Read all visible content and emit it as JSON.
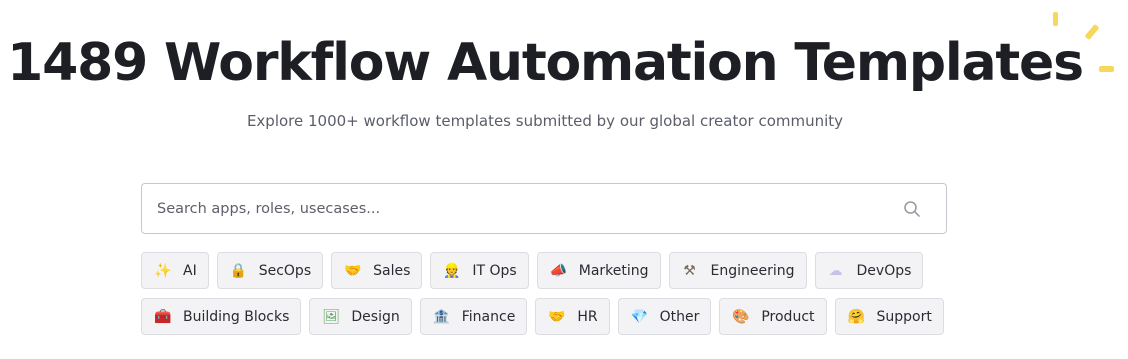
{
  "hero": {
    "title": "1489 Workflow Automation Templates",
    "subtitle": "Explore 1000+ workflow templates submitted by our global creator community",
    "sparkle_color": "#f6d95b"
  },
  "search": {
    "placeholder": "Search apps, roles, usecases...",
    "value": "",
    "icon": "search-icon"
  },
  "categories": {
    "row1": [
      {
        "emoji": "✨",
        "label": "AI",
        "icon": "sparkles-icon",
        "color": "#f5b400"
      },
      {
        "emoji": "🔒",
        "label": "SecOps",
        "icon": "lock-icon",
        "color": "#e0a81c"
      },
      {
        "emoji": "🤝",
        "label": "Sales",
        "icon": "handshake-icon",
        "color": "#e9a420"
      },
      {
        "emoji": "👷",
        "label": "IT Ops",
        "icon": "construction-worker-icon",
        "color": "#c48a2a"
      },
      {
        "emoji": "📣",
        "label": "Marketing",
        "icon": "megaphone-icon",
        "color": "#f0a81c"
      },
      {
        "emoji": "⚒",
        "label": "Engineering",
        "icon": "hammer-pick-icon",
        "color": "#7a6a5a"
      },
      {
        "emoji": "☁",
        "label": "DevOps",
        "icon": "cloud-icon",
        "color": "#c7c3e8"
      }
    ],
    "row2": [
      {
        "emoji": "🧰",
        "label": "Building Blocks",
        "icon": "toolbox-icon",
        "color": "#d93a3a"
      },
      {
        "emoji": "🖼",
        "label": "Design",
        "icon": "framed-picture-icon",
        "color": "#5aa35a"
      },
      {
        "emoji": "🏦",
        "label": "Finance",
        "icon": "bank-icon",
        "color": "#8a8f99"
      },
      {
        "emoji": "🤝",
        "label": "HR",
        "icon": "handshake-icon",
        "color": "#e9a420"
      },
      {
        "emoji": "💎",
        "label": "Other",
        "icon": "gem-icon",
        "color": "#3aa0e0"
      },
      {
        "emoji": "🎨",
        "label": "Product",
        "icon": "palette-icon",
        "color": "#e07a8a"
      },
      {
        "emoji": "🤗",
        "label": "Support",
        "icon": "hugging-face-icon",
        "color": "#f5b400"
      }
    ]
  }
}
